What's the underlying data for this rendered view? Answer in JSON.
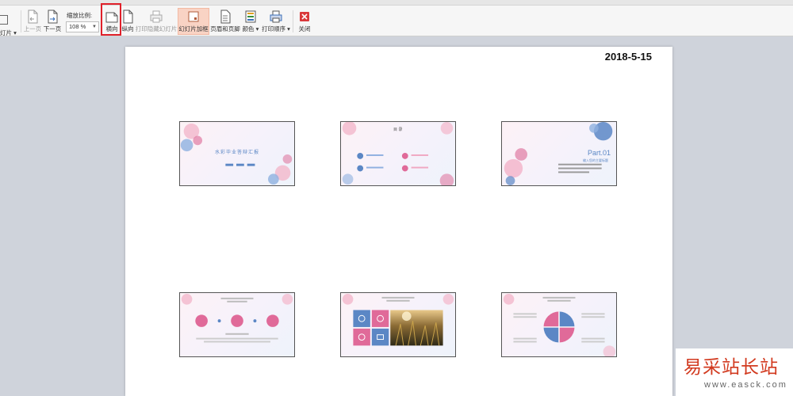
{
  "toolbar": {
    "left_cut_label": "灯片 ▾",
    "prev_page": "上一页",
    "next_page": "下一页",
    "zoom_label": "缩放比例:",
    "zoom_value": "108 %",
    "landscape": "横向",
    "portrait": "纵向",
    "print_hidden": "打印隐藏幻灯片",
    "slide_frame": "幻灯片加框",
    "header_footer": "页眉和页脚",
    "color": "颜色 ▾",
    "print_order": "打印顺序 ▾",
    "close": "关闭"
  },
  "page": {
    "date": "2018-5-15"
  },
  "slides": [
    {
      "title": "水彩毕业答辩汇报",
      "accent": "#5b87c5"
    },
    {
      "title": "目 录",
      "accent": "#e06a99"
    },
    {
      "title": "Part.01",
      "subtitle": "输入您的主要标题",
      "accent": "#5b87c5"
    },
    {
      "accent": "#e06a99"
    },
    {
      "accent": "#5b87c5"
    },
    {
      "accent": "#e06a99"
    }
  ],
  "watermark": {
    "title": "易采站长站",
    "url": "www.easck.com"
  },
  "colors": {
    "highlight": "#e0202a",
    "pink": "#e06a99",
    "blue": "#5b87c5",
    "close_red": "#d9383a"
  }
}
